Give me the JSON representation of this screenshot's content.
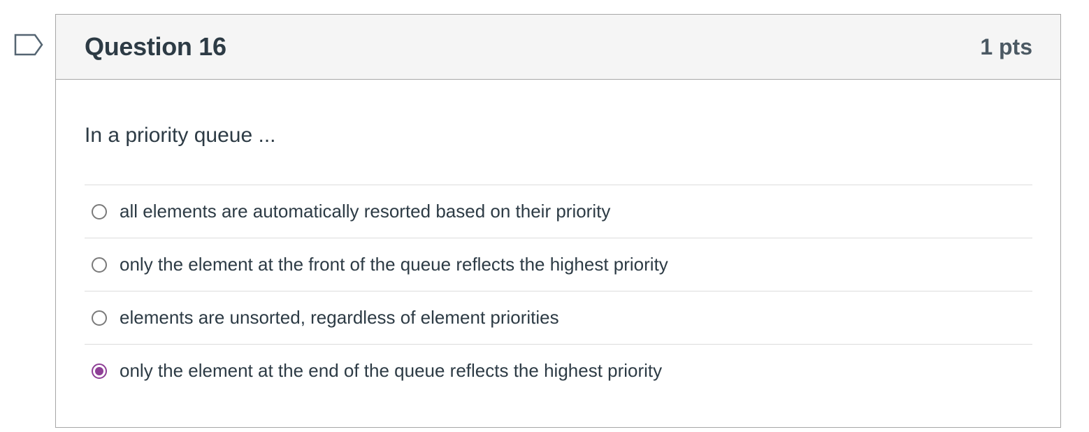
{
  "question": {
    "title": "Question 16",
    "points": "1 pts",
    "text": "In a priority queue ...",
    "flag_icon": "bookmark-flag-icon"
  },
  "answers": [
    {
      "label": "all elements are automatically resorted based on their priority",
      "selected": false
    },
    {
      "label": "only the element at the front of the queue reflects the highest priority",
      "selected": false
    },
    {
      "label": "elements are unsorted, regardless of element priorities",
      "selected": false
    },
    {
      "label": "only the element at the end of the queue reflects the highest priority",
      "selected": true
    }
  ],
  "colors": {
    "accent": "#8e3f96",
    "header_bg": "#f5f5f5",
    "border": "#a7a7a7",
    "text": "#2d3b45"
  }
}
